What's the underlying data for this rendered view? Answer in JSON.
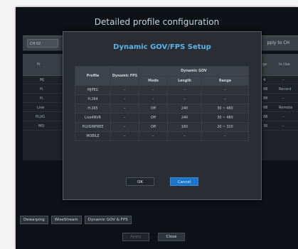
{
  "screen": {
    "title": "Detailed profile configuration"
  },
  "subbar": {
    "channel": "CH 02",
    "apply_to": "pply to CH"
  },
  "background_table": {
    "left_header": "Pr",
    "right_header_1": "ge",
    "right_header_2": "In Use",
    "left_rows": [
      "MJ",
      "H.",
      "H.",
      "Live",
      "PLUG",
      "MO"
    ],
    "right_rows": [
      [
        "4",
        "–"
      ],
      [
        "88",
        "Record"
      ],
      [
        "88",
        "–"
      ],
      [
        "88",
        "Remote"
      ],
      [
        "88",
        "–"
      ],
      [
        "30",
        "–"
      ]
    ]
  },
  "dialog": {
    "title": "Dynamic GOV/FPS Setup",
    "headers": {
      "profile": "Profile",
      "dynamic_fps": "Dynamic FPS",
      "dynamic_gov": "Dynamic GOV",
      "mode": "Mode",
      "length": "Length",
      "range": "Range"
    },
    "rows": [
      {
        "profile": "MJPEG",
        "fps": "–",
        "mode": "–",
        "length": "–",
        "range": "–"
      },
      {
        "profile": "H.264",
        "fps": "–",
        "mode": "–",
        "length": "–",
        "range": "–"
      },
      {
        "profile": "H.265",
        "fps": "–",
        "mode": "Off",
        "length": "240",
        "range": "30 ~ 480"
      },
      {
        "profile": "Live4NVR",
        "fps": "–",
        "mode": "Off",
        "length": "240",
        "range": "30 ~ 480"
      },
      {
        "profile": "PLUGINFREE",
        "fps": "–",
        "mode": "Off",
        "length": "160",
        "range": "20 ~ 320"
      },
      {
        "profile": "MOBILE",
        "fps": "–",
        "mode": "–",
        "length": "–",
        "range": "–"
      }
    ],
    "ok_label": "OK",
    "cancel_label": "Cancel"
  },
  "tabs": [
    "Dewarping",
    "WiseStream",
    "Dynamic GOV & FPS"
  ],
  "bottom": {
    "apply_label": "Apply",
    "close_label": "Close"
  }
}
